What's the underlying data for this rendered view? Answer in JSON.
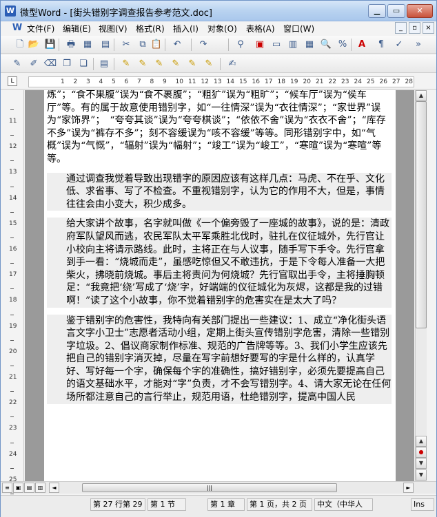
{
  "window": {
    "title": "微型Word - [街头错别字调查报告参考范文.doc]",
    "app_icon": "W",
    "btn_min": "▁",
    "btn_max": "▭",
    "btn_close": "✕"
  },
  "menu": {
    "items": [
      "文件(F)",
      "编辑(E)",
      "视图(V)",
      "格式(R)",
      "插入(I)",
      "对象(O)",
      "表格(A)",
      "窗口(W)"
    ],
    "doc_controls": [
      "_",
      "▫",
      "×"
    ]
  },
  "toolbar1": [
    "new-doc-icon",
    "open-folder-icon",
    "save-icon",
    "print-icon",
    "pdf-icon",
    "print-preview-icon",
    "cut-icon",
    "copy-icon",
    "paste-icon",
    "undo-icon",
    "redo-icon",
    "find-icon",
    "page-setup-icon",
    "frame-icon",
    "columns-icon",
    "table-icon",
    "zoom-icon",
    "percent-icon",
    "font-color-icon",
    "format-icon",
    "spellcheck-icon",
    "more-icon"
  ],
  "toolbar2": [
    "highlight-icon",
    "edit-icon",
    "erase-icon",
    "copy-page-icon",
    "copy-page2-icon",
    "clipboard-icon",
    "marker-icon",
    "marker2-icon",
    "marker3-icon",
    "marker4-icon",
    "marker5-icon",
    "marker6-icon",
    "notes-icon"
  ],
  "ruler": {
    "corner": "L",
    "numbers": [
      "1",
      "2",
      "3",
      "4",
      "5",
      "6",
      "7",
      "8",
      "9",
      "10",
      "11",
      "12",
      "13",
      "14",
      "15",
      "16",
      "17",
      "18",
      "19",
      "20",
      "21",
      "22",
      "23",
      "24",
      "25",
      "26",
      "27",
      "28"
    ]
  },
  "left_ruler": {
    "numbers": [
      "11",
      "12",
      "13",
      "14",
      "15",
      "16",
      "17",
      "18",
      "19",
      "20",
      "21",
      "22",
      "23",
      "24",
      "25",
      "26"
    ]
  },
  "document": {
    "paragraphs": [
      {
        "indent": false,
        "gap": false,
        "text": "炼”；“食不果腹”误为“食不裹腹”；“粗犷”误为“粗旷”；“候车厅”误为“侯车厅”等。有的属于故意使用错别字，如“一往情深”误为“衣往情深”；“家世界”误为“家饰界”；　“夸夸其谈”误为“夸夸棋谈”；“依依不舍”误为“衣衣不舍”；“库存不多”误为“裤存不多”；刻不容缓误为“咳不容缓”等等。同形错别字中，如“气概”误为“气慨”，“辐射”误为“幅射”；“竣工”误为“峻工”，“寒暄”误为“寒喧”等等。"
      },
      {
        "indent": true,
        "gap": true,
        "text": "通过调查我觉着导致出现错字的原因应该有这样几点：马虎、不在乎、文化低、求省事、写了不检查。不重视错别字，认为它的作用不大，但是，事情往往会由小变大，积少成多。"
      },
      {
        "indent": true,
        "gap": true,
        "text": "给大家讲个故事，名字就叫做《一个偏旁毁了一座城的故事》，说的是：清政府军队望风而逃，农民军队太平军乘胜北伐时，驻扎在仪征城外，先行官让小校向主将请示路线。此时，主将正在与人议事，随手写下手令。先行官拿到手一看：“烧城而走”，虽感吃惊但又不敢违抗，于是下令每人准备一大把柴火，拂晓前烧城。事后主将责问为何烧城？先行官取出手令，主将捶胸顿足：“我竟把‘绕’写成了‘烧’字，好端端的仪征城化为灰烬，这都是我的过错啊！”读了这个小故事，你不觉着错别字的危害实在是太大了吗？"
      },
      {
        "indent": true,
        "gap": true,
        "text": "鉴于错别字的危害性，我特向有关部门提出一些建议：1、成立“净化街头语言文字小卫士”志愿者活动小组，定期上街头宣传错别字危害，清除一些错别字垃圾。2、倡议商家制作标准、规范的广告牌等等。3、我们小学生应该先把自己的错别字消灭掉，尽量在写字前想好要写的字是什么样的，认真学好、写好每一个字，确保每个字的准确性，搞好错别字，必须先要提高自己的语文基础水平，才能对“字”负责，才不会写错别字。4、请大家无论在任何场所都注意自己的言行举止，规范用语，杜绝错别字，提高中国人民"
      }
    ]
  },
  "scroll": {
    "up": "▲",
    "down": "▼",
    "prev_page": "▲",
    "select_object": "●",
    "next_page": "▼",
    "left": "◄",
    "right": "►",
    "thumb_grip": "|||"
  },
  "view_buttons": [
    "≡",
    "▣",
    "▤",
    "▥"
  ],
  "status": {
    "line_col": "第 27 行第 29",
    "section": "第 1 节",
    "chapter": "第 1 章",
    "page": "第 1 页，共 2 页",
    "language": "中文（中华人",
    "ins": "Ins"
  },
  "colors": {
    "title_bar": "#b9d3f0",
    "close_button": "#c8523b",
    "page_background": "#9a9a9a"
  }
}
